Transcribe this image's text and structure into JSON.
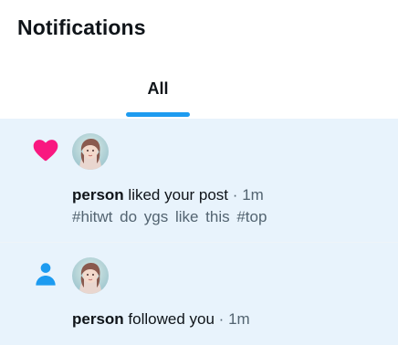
{
  "header": {
    "title": "Notifications"
  },
  "tabs": [
    {
      "label": "All",
      "active": true
    }
  ],
  "colors": {
    "accent": "#1d9bf0",
    "like": "#f91880",
    "highlight_bg": "#e8f3fc",
    "secondary_text": "#536471"
  },
  "notifications": [
    {
      "icon": "heart-icon",
      "actor": "person",
      "action": "liked your post",
      "separator": "·",
      "time": "1m",
      "snippet": "#hitwt do ygs like this #top"
    },
    {
      "icon": "person-icon",
      "actor": "person",
      "action": "followed you",
      "separator": "·",
      "time": "1m"
    }
  ]
}
